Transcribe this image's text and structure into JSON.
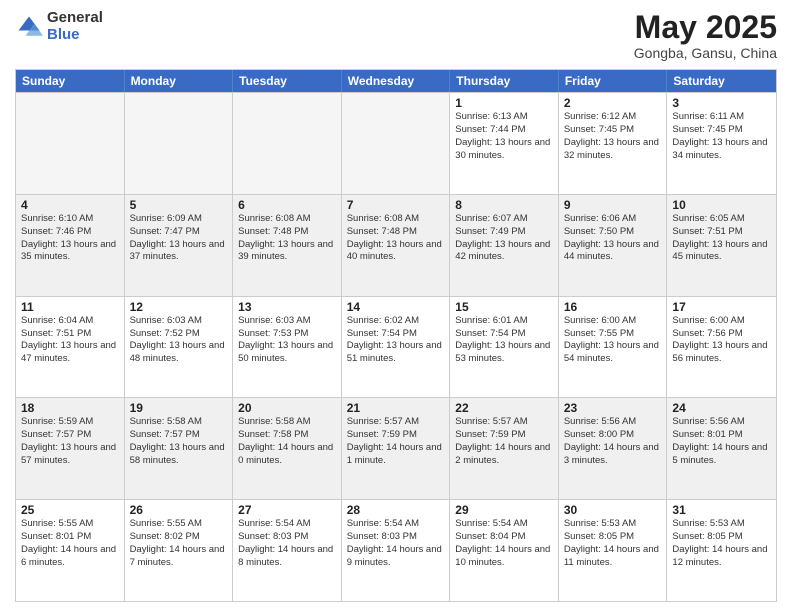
{
  "header": {
    "logo_general": "General",
    "logo_blue": "Blue",
    "month_title": "May 2025",
    "location": "Gongba, Gansu, China"
  },
  "weekdays": [
    "Sunday",
    "Monday",
    "Tuesday",
    "Wednesday",
    "Thursday",
    "Friday",
    "Saturday"
  ],
  "rows": [
    [
      {
        "day": "",
        "info": "",
        "empty": true
      },
      {
        "day": "",
        "info": "",
        "empty": true
      },
      {
        "day": "",
        "info": "",
        "empty": true
      },
      {
        "day": "",
        "info": "",
        "empty": true
      },
      {
        "day": "1",
        "info": "Sunrise: 6:13 AM\nSunset: 7:44 PM\nDaylight: 13 hours\nand 30 minutes."
      },
      {
        "day": "2",
        "info": "Sunrise: 6:12 AM\nSunset: 7:45 PM\nDaylight: 13 hours\nand 32 minutes."
      },
      {
        "day": "3",
        "info": "Sunrise: 6:11 AM\nSunset: 7:45 PM\nDaylight: 13 hours\nand 34 minutes."
      }
    ],
    [
      {
        "day": "4",
        "info": "Sunrise: 6:10 AM\nSunset: 7:46 PM\nDaylight: 13 hours\nand 35 minutes."
      },
      {
        "day": "5",
        "info": "Sunrise: 6:09 AM\nSunset: 7:47 PM\nDaylight: 13 hours\nand 37 minutes."
      },
      {
        "day": "6",
        "info": "Sunrise: 6:08 AM\nSunset: 7:48 PM\nDaylight: 13 hours\nand 39 minutes."
      },
      {
        "day": "7",
        "info": "Sunrise: 6:08 AM\nSunset: 7:48 PM\nDaylight: 13 hours\nand 40 minutes."
      },
      {
        "day": "8",
        "info": "Sunrise: 6:07 AM\nSunset: 7:49 PM\nDaylight: 13 hours\nand 42 minutes."
      },
      {
        "day": "9",
        "info": "Sunrise: 6:06 AM\nSunset: 7:50 PM\nDaylight: 13 hours\nand 44 minutes."
      },
      {
        "day": "10",
        "info": "Sunrise: 6:05 AM\nSunset: 7:51 PM\nDaylight: 13 hours\nand 45 minutes."
      }
    ],
    [
      {
        "day": "11",
        "info": "Sunrise: 6:04 AM\nSunset: 7:51 PM\nDaylight: 13 hours\nand 47 minutes."
      },
      {
        "day": "12",
        "info": "Sunrise: 6:03 AM\nSunset: 7:52 PM\nDaylight: 13 hours\nand 48 minutes."
      },
      {
        "day": "13",
        "info": "Sunrise: 6:03 AM\nSunset: 7:53 PM\nDaylight: 13 hours\nand 50 minutes."
      },
      {
        "day": "14",
        "info": "Sunrise: 6:02 AM\nSunset: 7:54 PM\nDaylight: 13 hours\nand 51 minutes."
      },
      {
        "day": "15",
        "info": "Sunrise: 6:01 AM\nSunset: 7:54 PM\nDaylight: 13 hours\nand 53 minutes."
      },
      {
        "day": "16",
        "info": "Sunrise: 6:00 AM\nSunset: 7:55 PM\nDaylight: 13 hours\nand 54 minutes."
      },
      {
        "day": "17",
        "info": "Sunrise: 6:00 AM\nSunset: 7:56 PM\nDaylight: 13 hours\nand 56 minutes."
      }
    ],
    [
      {
        "day": "18",
        "info": "Sunrise: 5:59 AM\nSunset: 7:57 PM\nDaylight: 13 hours\nand 57 minutes."
      },
      {
        "day": "19",
        "info": "Sunrise: 5:58 AM\nSunset: 7:57 PM\nDaylight: 13 hours\nand 58 minutes."
      },
      {
        "day": "20",
        "info": "Sunrise: 5:58 AM\nSunset: 7:58 PM\nDaylight: 14 hours\nand 0 minutes."
      },
      {
        "day": "21",
        "info": "Sunrise: 5:57 AM\nSunset: 7:59 PM\nDaylight: 14 hours\nand 1 minute."
      },
      {
        "day": "22",
        "info": "Sunrise: 5:57 AM\nSunset: 7:59 PM\nDaylight: 14 hours\nand 2 minutes."
      },
      {
        "day": "23",
        "info": "Sunrise: 5:56 AM\nSunset: 8:00 PM\nDaylight: 14 hours\nand 3 minutes."
      },
      {
        "day": "24",
        "info": "Sunrise: 5:56 AM\nSunset: 8:01 PM\nDaylight: 14 hours\nand 5 minutes."
      }
    ],
    [
      {
        "day": "25",
        "info": "Sunrise: 5:55 AM\nSunset: 8:01 PM\nDaylight: 14 hours\nand 6 minutes."
      },
      {
        "day": "26",
        "info": "Sunrise: 5:55 AM\nSunset: 8:02 PM\nDaylight: 14 hours\nand 7 minutes."
      },
      {
        "day": "27",
        "info": "Sunrise: 5:54 AM\nSunset: 8:03 PM\nDaylight: 14 hours\nand 8 minutes."
      },
      {
        "day": "28",
        "info": "Sunrise: 5:54 AM\nSunset: 8:03 PM\nDaylight: 14 hours\nand 9 minutes."
      },
      {
        "day": "29",
        "info": "Sunrise: 5:54 AM\nSunset: 8:04 PM\nDaylight: 14 hours\nand 10 minutes."
      },
      {
        "day": "30",
        "info": "Sunrise: 5:53 AM\nSunset: 8:05 PM\nDaylight: 14 hours\nand 11 minutes."
      },
      {
        "day": "31",
        "info": "Sunrise: 5:53 AM\nSunset: 8:05 PM\nDaylight: 14 hours\nand 12 minutes."
      }
    ]
  ]
}
